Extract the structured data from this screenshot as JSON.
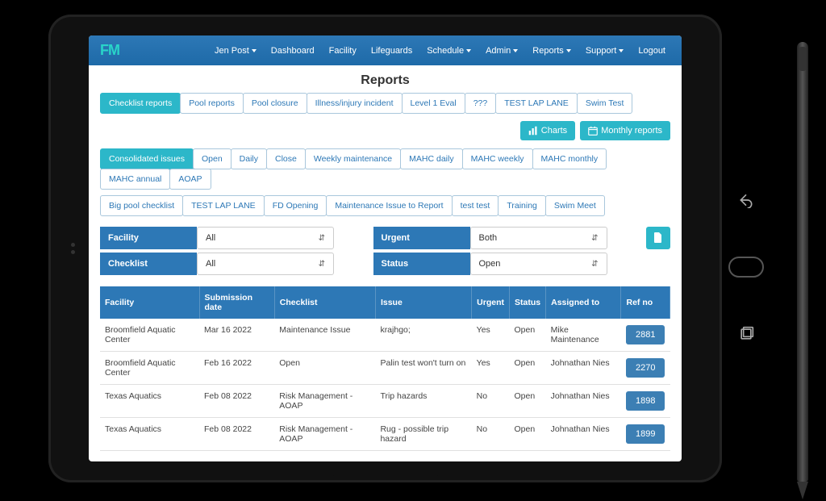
{
  "brand": "FM",
  "nav": {
    "user": "Jen Post",
    "items": [
      "Dashboard",
      "Facility",
      "Lifeguards"
    ],
    "dropdowns": [
      "Schedule",
      "Admin",
      "Reports",
      "Support"
    ],
    "logout": "Logout"
  },
  "page_title": "Reports",
  "report_tabs": [
    "Checklist reports",
    "Pool reports",
    "Pool closure",
    "Illness/injury incident",
    "Level 1 Eval",
    "???",
    "TEST LAP LANE",
    "Swim Test"
  ],
  "actions": {
    "charts": "Charts",
    "monthly": "Monthly reports"
  },
  "issue_tabs_row1": [
    "Consolidated issues",
    "Open",
    "Daily",
    "Close",
    "Weekly maintenance",
    "MAHC daily",
    "MAHC weekly",
    "MAHC monthly",
    "MAHC annual",
    "AOAP"
  ],
  "issue_tabs_row2": [
    "Big pool checklist",
    "TEST LAP LANE",
    "FD Opening",
    "Maintenance Issue to Report",
    "test test",
    "Training",
    "Swim Meet"
  ],
  "filters": {
    "facility_label": "Facility",
    "facility_value": "All",
    "urgent_label": "Urgent",
    "urgent_value": "Both",
    "checklist_label": "Checklist",
    "checklist_value": "All",
    "status_label": "Status",
    "status_value": "Open"
  },
  "columns": [
    "Facility",
    "Submission date",
    "Checklist",
    "Issue",
    "Urgent",
    "Status",
    "Assigned to",
    "Ref no"
  ],
  "rows": [
    {
      "facility": "Broomfield Aquatic Center",
      "date": "Mar 16 2022",
      "checklist": "Maintenance Issue",
      "issue": "krajhgo;",
      "urgent": "Yes",
      "status": "Open",
      "assigned": "Mike Maintenance",
      "ref": "2881"
    },
    {
      "facility": "Broomfield Aquatic Center",
      "date": "Feb 16 2022",
      "checklist": "Open",
      "issue": "Palin test won't turn on",
      "urgent": "Yes",
      "status": "Open",
      "assigned": "Johnathan Nies",
      "ref": "2270"
    },
    {
      "facility": "Texas Aquatics",
      "date": "Feb 08 2022",
      "checklist": "Risk Management - AOAP",
      "issue": "Trip hazards",
      "urgent": "No",
      "status": "Open",
      "assigned": "Johnathan Nies",
      "ref": "1898"
    },
    {
      "facility": "Texas Aquatics",
      "date": "Feb 08 2022",
      "checklist": "Risk Management - AOAP",
      "issue": "Rug - possible trip hazard",
      "urgent": "No",
      "status": "Open",
      "assigned": "Johnathan Nies",
      "ref": "1899"
    }
  ]
}
